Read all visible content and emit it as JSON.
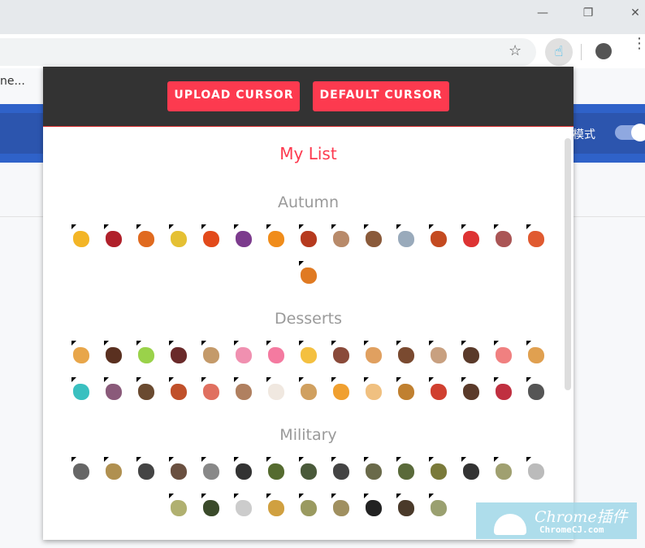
{
  "browser": {
    "minimize": "—",
    "restore": "❐",
    "close": "✕",
    "bookmark_text": "ne...",
    "star": "☆",
    "ext_icon": "☝",
    "menu": "⋮"
  },
  "page": {
    "mode_label": "模式"
  },
  "popup": {
    "upload_label": "UPLOAD CURSOR",
    "default_label": "DEFAULT CURSOR",
    "my_list": "My List",
    "categories": [
      {
        "name": "Autumn",
        "icons": [
          "umbrella",
          "maple-leaf",
          "leaf",
          "corn",
          "leaves",
          "eggplant",
          "orange-leaf",
          "branch",
          "mushroom",
          "axe",
          "umbrella-closed",
          "red-leaf",
          "rain-boot",
          "boot",
          "fox",
          "acorns"
        ],
        "colors": [
          "#f3b526",
          "#b0202a",
          "#e06a1f",
          "#e5c033",
          "#e24a1b",
          "#7c3b8d",
          "#f08c1a",
          "#b63a1e",
          "#b88a6a",
          "#8a5a3a",
          "#9ab",
          "#c44a20",
          "#d33",
          "#a55",
          "#e05a30",
          "#e07a22"
        ]
      },
      {
        "name": "Desserts",
        "icons": [
          "croissant",
          "roll-cake",
          "macaron",
          "chocolate-cake",
          "cake-slice",
          "pink-cake",
          "cupcake",
          "cheese-cake",
          "cupcake2",
          "layer-cake",
          "chocolates",
          "tiered-cake",
          "brownie",
          "strawberry-cake",
          "muffin",
          "teal-cake",
          "tall-cake",
          "cake-stand",
          "donut",
          "donut2",
          "coffee",
          "milk",
          "sandwich",
          "juice",
          "pancake",
          "burger",
          "soda",
          "coffee-cup",
          "strawberry-drink",
          "grill"
        ],
        "colors": [
          "#e8a64a",
          "#5a3020",
          "#9ad24a",
          "#6a2a2a",
          "#c49a6a",
          "#f090b0",
          "#f47aa0",
          "#f4c040",
          "#8a4a3a",
          "#e0a060",
          "#7a4a30",
          "#c8a080",
          "#5a3a2a",
          "#f08080",
          "#e0a050",
          "#3ac0c0",
          "#8a5a7a",
          "#6a4a30",
          "#c0502a",
          "#e07060",
          "#b08060",
          "#f0e8e0",
          "#d0a060",
          "#f0a030",
          "#f0c080",
          "#c08030",
          "#d04030",
          "#5a3a2a",
          "#c03040",
          "#555"
        ]
      },
      {
        "name": "Military",
        "icons": [
          "sword",
          "dagger",
          "jet",
          "glove",
          "hook",
          "grenade",
          "shield",
          "vest",
          "knife",
          "target",
          "binoculars",
          "missile",
          "bayonet",
          "submarine",
          "pistol",
          "bomb",
          "fighter-plane",
          "dog-tag",
          "bullet",
          "torpedo",
          "ammo-box",
          "handgun",
          "rifle",
          "tank"
        ],
        "colors": [
          "#666",
          "#b09050",
          "#444",
          "#6a5040",
          "#888",
          "#333",
          "#556b2f",
          "#4a5a3a",
          "#444",
          "#6a6a4a",
          "#5a6a3a",
          "#7a7a3a",
          "#333",
          "#a0a070",
          "#bbb",
          "#b0b070",
          "#3a4a2a",
          "#ccc",
          "#d0a040",
          "#9a9a60",
          "#a09060",
          "#222",
          "#4a3a2a",
          "#9aa070"
        ]
      }
    ]
  },
  "watermark": {
    "line1": "Chrome插件",
    "line2": "ChromeCJ.com"
  }
}
